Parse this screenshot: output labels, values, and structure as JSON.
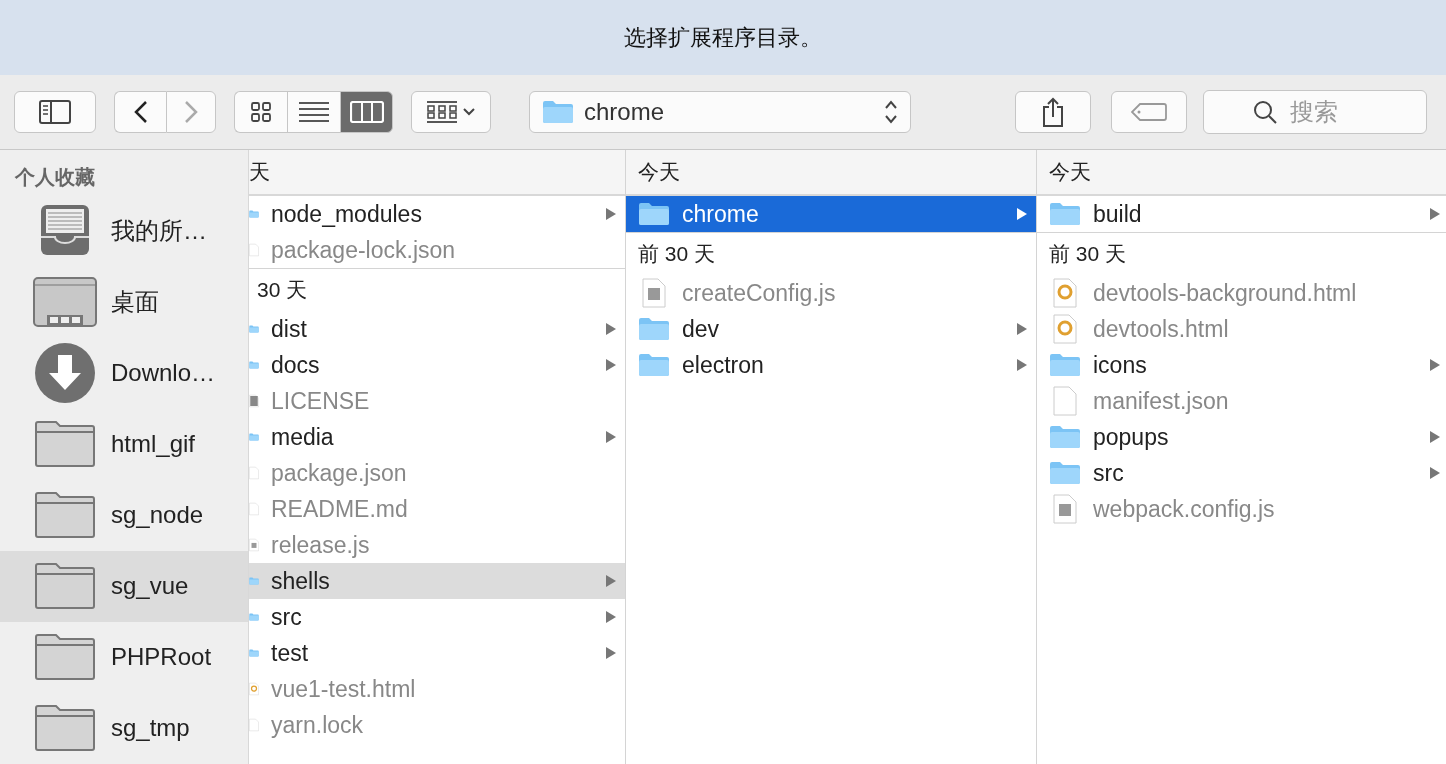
{
  "window": {
    "title": "选择扩展程序目录。"
  },
  "toolbar": {
    "views": [
      {
        "kind": "icons",
        "selected": false
      },
      {
        "kind": "list",
        "selected": false
      },
      {
        "kind": "columns",
        "selected": true
      }
    ],
    "back_enabled": true,
    "forward_enabled": false,
    "path": "chrome",
    "search": {
      "placeholder": "搜索"
    }
  },
  "sidebar": {
    "heading": "个人收藏",
    "items": [
      {
        "kind": "tray",
        "label": "我的所…",
        "selected": false
      },
      {
        "kind": "desktop",
        "label": "桌面",
        "selected": false
      },
      {
        "kind": "download",
        "label": "Downlo…",
        "selected": false
      },
      {
        "kind": "folder",
        "label": "html_gif",
        "selected": false
      },
      {
        "kind": "folder",
        "label": "sg_node",
        "selected": false
      },
      {
        "kind": "folder",
        "label": "sg_vue",
        "selected": true
      },
      {
        "kind": "folder",
        "label": "PHPRoot",
        "selected": false
      },
      {
        "kind": "folder",
        "label": "sg_tmp",
        "selected": false
      }
    ]
  },
  "columns": [
    {
      "sections": [
        {
          "header": "天",
          "items": [
            {
              "kind": "folder",
              "name": "node_modules",
              "selected": false
            },
            {
              "kind": "file",
              "name": "package-lock.json",
              "selected": false
            }
          ]
        },
        {
          "header": "30 天",
          "items": [
            {
              "kind": "folder",
              "name": "dist",
              "selected": false
            },
            {
              "kind": "folder",
              "name": "docs",
              "selected": false
            },
            {
              "kind": "binary",
              "name": "LICENSE",
              "selected": false
            },
            {
              "kind": "folder",
              "name": "media",
              "selected": false
            },
            {
              "kind": "file",
              "name": "package.json",
              "selected": false
            },
            {
              "kind": "file",
              "name": "README.md",
              "selected": false
            },
            {
              "kind": "js",
              "name": "release.js",
              "selected": false
            },
            {
              "kind": "folder",
              "name": "shells",
              "selected": true
            },
            {
              "kind": "folder",
              "name": "src",
              "selected": false
            },
            {
              "kind": "folder",
              "name": "test",
              "selected": false
            },
            {
              "kind": "html",
              "name": "vue1-test.html",
              "selected": false
            },
            {
              "kind": "file",
              "name": "yarn.lock",
              "selected": false
            }
          ]
        }
      ]
    },
    {
      "sections": [
        {
          "header": "今天",
          "items": [
            {
              "kind": "folder",
              "name": "chrome",
              "selected": true
            }
          ]
        },
        {
          "header": "前 30 天",
          "items": [
            {
              "kind": "js",
              "name": "createConfig.js",
              "selected": false
            },
            {
              "kind": "folder",
              "name": "dev",
              "selected": false
            },
            {
              "kind": "folder",
              "name": "electron",
              "selected": false
            }
          ]
        }
      ]
    },
    {
      "sections": [
        {
          "header": "今天",
          "items": [
            {
              "kind": "folder",
              "name": "build",
              "selected": false
            }
          ]
        },
        {
          "header": "前 30 天",
          "items": [
            {
              "kind": "html",
              "name": "devtools-background.html",
              "selected": false
            },
            {
              "kind": "html",
              "name": "devtools.html",
              "selected": false
            },
            {
              "kind": "folder",
              "name": "icons",
              "selected": false
            },
            {
              "kind": "file",
              "name": "manifest.json",
              "selected": false
            },
            {
              "kind": "folder",
              "name": "popups",
              "selected": false
            },
            {
              "kind": "folder",
              "name": "src",
              "selected": false
            },
            {
              "kind": "js",
              "name": "webpack.config.js",
              "selected": false
            }
          ]
        }
      ]
    }
  ]
}
